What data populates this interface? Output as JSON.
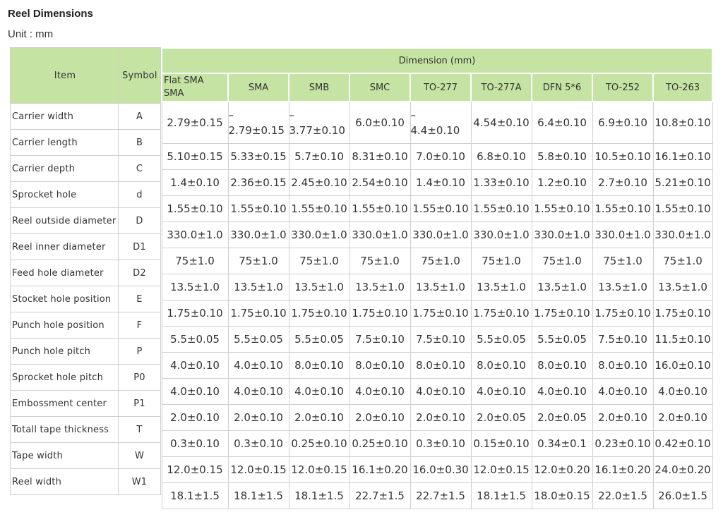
{
  "page": {
    "title": "Reel Dimensions",
    "unit": "Unit : mm"
  },
  "table": {
    "item_header": "Item",
    "symbol_header": "Symbol",
    "dimension_header": "Dimension (mm)",
    "packages": [
      "Flat SMA\nSMA",
      "SMA",
      "SMB",
      "SMC",
      "TO-277",
      "TO-277A",
      "DFN 5*6",
      "TO-252",
      "TO-263"
    ],
    "rows": [
      {
        "item": "Carrier width",
        "symbol": "A",
        "values": [
          "2.79±0.15",
          "–\n2.79±0.15",
          "–\n3.77±0.10",
          "6.0±0.10",
          "–\n4.4±0.10",
          "4.54±0.10",
          "6.4±0.10",
          "6.9±0.10",
          "10.8±0.10"
        ]
      },
      {
        "item": "Carrier length",
        "symbol": "B",
        "values": [
          "5.10±0.15",
          "5.33±0.15",
          "5.7±0.10",
          "8.31±0.10",
          "7.0±0.10",
          "6.8±0.10",
          "5.8±0.10",
          "10.5±0.10",
          "16.1±0.10"
        ]
      },
      {
        "item": "Carrier depth",
        "symbol": "C",
        "values": [
          "1.4±0.10",
          "2.36±0.15",
          "2.45±0.10",
          "2.54±0.10",
          "1.4±0.10",
          "1.33±0.10",
          "1.2±0.10",
          "2.7±0.10",
          "5.21±0.10"
        ]
      },
      {
        "item": "Sprocket hole",
        "symbol": "d",
        "values": [
          "1.55±0.10",
          "1.55±0.10",
          "1.55±0.10",
          "1.55±0.10",
          "1.55±0.10",
          "1.55±0.10",
          "1.55±0.10",
          "1.55±0.10",
          "1.55±0.10"
        ]
      },
      {
        "item": "Reel outside diameter",
        "symbol": "D",
        "values": [
          "330.0±1.0",
          "330.0±1.0",
          "330.0±1.0",
          "330.0±1.0",
          "330.0±1.0",
          "330.0±1.0",
          "330.0±1.0",
          "330.0±1.0",
          "330.0±1.0"
        ]
      },
      {
        "item": "Reel inner diameter",
        "symbol": "D1",
        "values": [
          "75±1.0",
          "75±1.0",
          "75±1.0",
          "75±1.0",
          "75±1.0",
          "75±1.0",
          "75±1.0",
          "75±1.0",
          "75±1.0"
        ]
      },
      {
        "item": "Feed hole diameter",
        "symbol": "D2",
        "values": [
          "13.5±1.0",
          "13.5±1.0",
          "13.5±1.0",
          "13.5±1.0",
          "13.5±1.0",
          "13.5±1.0",
          "13.5±1.0",
          "13.5±1.0",
          "13.5±1.0"
        ]
      },
      {
        "item": "Stocket hole position",
        "symbol": "E",
        "values": [
          "1.75±0.10",
          "1.75±0.10",
          "1.75±0.10",
          "1.75±0.10",
          "1.75±0.10",
          "1.75±0.10",
          "1.75±0.10",
          "1.75±0.10",
          "1.75±0.10"
        ]
      },
      {
        "item": "Punch hole position",
        "symbol": "F",
        "values": [
          "5.5±0.05",
          "5.5±0.05",
          "5.5±0.05",
          "7.5±0.10",
          "7.5±0.10",
          "5.5±0.05",
          "5.5±0.05",
          "7.5±0.10",
          "11.5±0.10"
        ]
      },
      {
        "item": "Punch hole pitch",
        "symbol": "P",
        "values": [
          "4.0±0.10",
          "4.0±0.10",
          "8.0±0.10",
          "8.0±0.10",
          "8.0±0.10",
          "8.0±0.10",
          "8.0±0.10",
          "8.0±0.10",
          "16.0±0.10"
        ]
      },
      {
        "item": "Sprocket hole pitch",
        "symbol": "P0",
        "values": [
          "4.0±0.10",
          "4.0±0.10",
          "4.0±0.10",
          "4.0±0.10",
          "4.0±0.10",
          "4.0±0.10",
          "4.0±0.10",
          "4.0±0.10",
          "4.0±0.10"
        ]
      },
      {
        "item": "Embossment center",
        "symbol": "P1",
        "values": [
          "2.0±0.10",
          "2.0±0.10",
          "2.0±0.10",
          "2.0±0.10",
          "2.0±0.10",
          "2.0±0.05",
          "2.0±0.05",
          "2.0±0.10",
          "2.0±0.10"
        ]
      },
      {
        "item": "Totall tape thickness",
        "symbol": "T",
        "values": [
          "0.3±0.10",
          "0.3±0.10",
          "0.25±0.10",
          "0.25±0.10",
          "0.3±0.10",
          "0.15±0.10",
          "0.34±0.1",
          "0.23±0.10",
          "0.42±0.10"
        ]
      },
      {
        "item": "Tape width",
        "symbol": "W",
        "values": [
          "12.0±0.15",
          "12.0±0.15",
          "12.0±0.15",
          "16.1±0.20",
          "16.0±0.30",
          "12.0±0.15",
          "12.0±0.20",
          "16.1±0.20",
          "24.0±0.20"
        ]
      },
      {
        "item": "Reel width",
        "symbol": "W1",
        "values": [
          "18.1±1.5",
          "18.1±1.5",
          "18.1±1.5",
          "22.7±1.5",
          "22.7±1.5",
          "18.1±1.5",
          "18.0±0.15",
          "22.0±1.5",
          "26.0±1.5"
        ]
      }
    ]
  }
}
